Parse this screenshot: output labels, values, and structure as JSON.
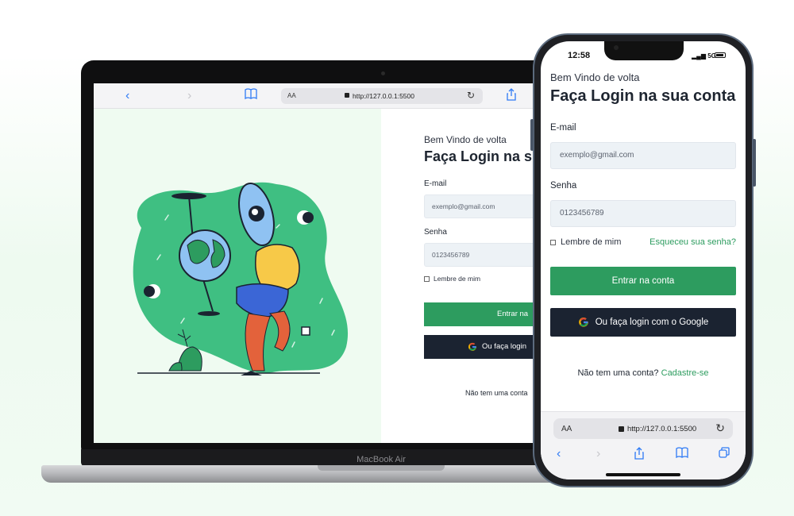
{
  "colors": {
    "primary_green": "#2d9c5f",
    "dark_button": "#1b2331",
    "input_bg": "#edf2f6",
    "safari_blue": "#2f7bf5",
    "illustration_green": "#3fbf82"
  },
  "desktop": {
    "device_label": "MacBook Air",
    "browser": {
      "text_size_label": "AA",
      "url": "http://127.0.0.1:5500",
      "icons": [
        "back-icon",
        "forward-icon",
        "bookmarks-icon",
        "reload-icon",
        "share-icon"
      ]
    },
    "form": {
      "welcome": "Bem Vindo de volta",
      "title": "Faça Login na s",
      "email_label": "E-mail",
      "email_placeholder": "exemplo@gmail.com",
      "password_label": "Senha",
      "password_value": "0123456789",
      "remember_label": "Lembre de mim",
      "submit_label": "Entrar na",
      "google_label": "Ou faça login",
      "signup_text": "Não tem uma conta"
    }
  },
  "mobile": {
    "status": {
      "time": "12:58",
      "network": "5G"
    },
    "form": {
      "welcome": "Bem Vindo de volta",
      "title": "Faça Login na sua conta",
      "email_label": "E-mail",
      "email_placeholder": "exemplo@gmail.com",
      "password_label": "Senha",
      "password_value": "0123456789",
      "remember_label": "Lembre de mim",
      "forgot_label": "Esqueceu sua senha?",
      "submit_label": "Entrar na conta",
      "google_label": "Ou faça login com o Google",
      "signup_prefix": "Não tem uma conta?",
      "signup_link": "Cadastre-se"
    },
    "browser": {
      "text_size_label": "AA",
      "url": "http://127.0.0.1:5500",
      "icons": [
        "back-icon",
        "forward-icon",
        "share-icon",
        "bookmarks-icon",
        "tabs-icon"
      ]
    }
  }
}
